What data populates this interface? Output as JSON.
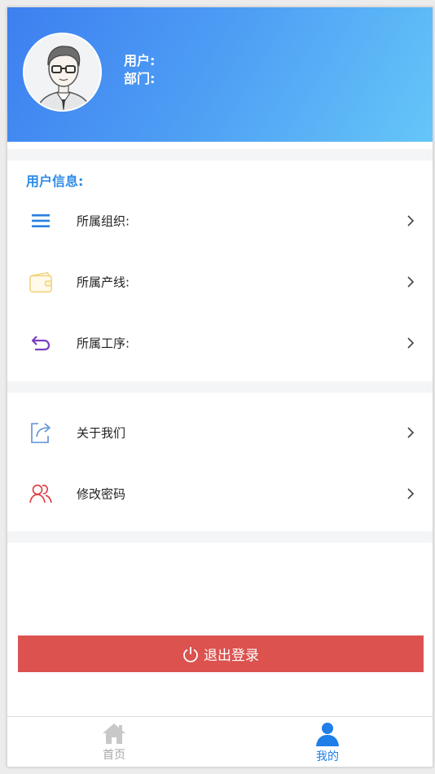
{
  "profile": {
    "user_label": "用户:",
    "dept_label": "部门:"
  },
  "user_info": {
    "section_title": "用户信息:",
    "items": [
      {
        "label": "所属组织:",
        "icon": "list-icon"
      },
      {
        "label": "所属产线:",
        "icon": "wallet-icon"
      },
      {
        "label": "所属工序:",
        "icon": "return-arrow-icon"
      }
    ]
  },
  "more": {
    "items": [
      {
        "label": "关于我们",
        "icon": "share-icon"
      },
      {
        "label": "修改密码",
        "icon": "users-icon"
      }
    ]
  },
  "logout": {
    "label": "退出登录",
    "icon": "power-icon"
  },
  "tabbar": {
    "tabs": [
      {
        "label": "首页",
        "icon": "home-icon",
        "active": false
      },
      {
        "label": "我的",
        "icon": "person-icon",
        "active": true
      }
    ]
  },
  "colors": {
    "header_start": "#3d7ff0",
    "header_end": "#66c6f8",
    "section_title": "#2e8ce6",
    "logout_bg": "#db524f",
    "tab_active": "#1f7ee8",
    "tab_inactive": "#a6a6a6"
  }
}
